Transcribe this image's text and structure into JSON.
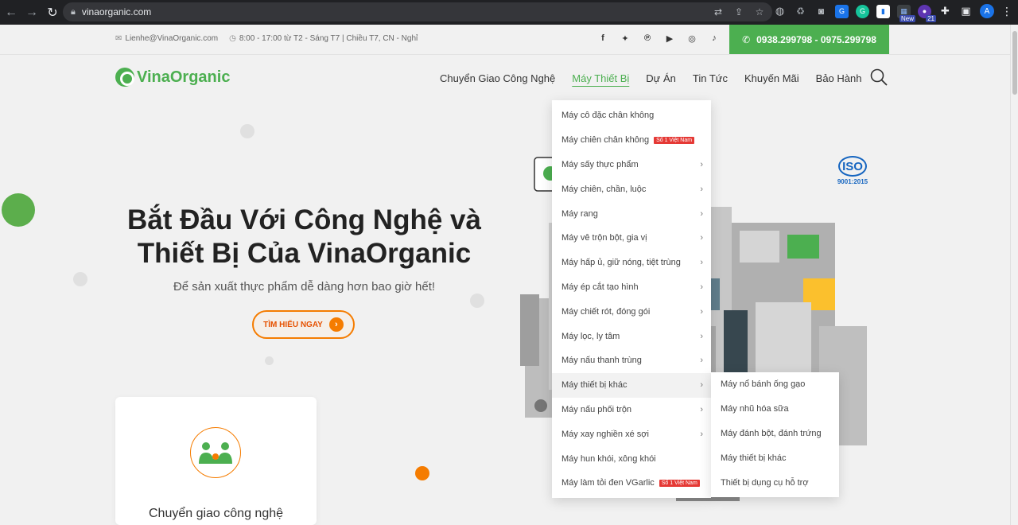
{
  "browser": {
    "url": "vinaorganic.com",
    "profile_initial": "A",
    "ext_new_label": "New",
    "ext_badge": "21"
  },
  "topbar": {
    "email": "Lienhe@VinaOrganic.com",
    "hours": "8:00 - 17:00 từ T2 - Sáng T7 | Chiều T7, CN - Nghỉ",
    "phone": "0938.299798 - 0975.299798"
  },
  "header": {
    "logo": "VinaOrganic",
    "menu": [
      {
        "label": "Chuyển Giao Công Nghệ"
      },
      {
        "label": "Máy Thiết Bị"
      },
      {
        "label": "Dự Án"
      },
      {
        "label": "Tin Tức"
      },
      {
        "label": "Khuyến Mãi"
      },
      {
        "label": "Bảo Hành"
      }
    ]
  },
  "hero": {
    "title_line1": "Bắt Đầu Với Công Nghệ và",
    "title_line2": "Thiết Bị Của VinaOrganic",
    "subtitle": "Để sản xuất thực phẩm dễ dàng hơn bao giờ hết!",
    "cta": "TÌM HIỂU NGAY"
  },
  "card": {
    "title": "Chuyển giao công nghệ"
  },
  "iso": {
    "text": "ISO",
    "sub": "9001:2015"
  },
  "dropdown": {
    "items": [
      {
        "label": "Máy cô đặc chân không"
      },
      {
        "label": "Máy chiên chân không",
        "tag": "Số 1 Việt Nam"
      },
      {
        "label": "Máy sấy thực phẩm"
      },
      {
        "label": "Máy chiên, chần, luộc"
      },
      {
        "label": "Máy rang"
      },
      {
        "label": "Máy vê trộn bột, gia vị"
      },
      {
        "label": "Máy hấp ủ, giữ nóng, tiệt trùng"
      },
      {
        "label": "Máy ép cắt tạo hình"
      },
      {
        "label": "Máy chiết rót, đóng gói"
      },
      {
        "label": "Máy lọc, ly tâm"
      },
      {
        "label": "Máy nấu thanh trùng"
      },
      {
        "label": "Máy thiết bị khác"
      },
      {
        "label": "Máy nấu phối trộn"
      },
      {
        "label": "Máy xay nghiền xé sợi"
      },
      {
        "label": "Máy hun khói, xông khói"
      },
      {
        "label": "Máy làm tỏi đen VGarlic",
        "tag": "Số 1 Việt Nam"
      }
    ],
    "submenu": [
      {
        "label": "Máy nổ bánh ống gạo"
      },
      {
        "label": "Máy nhũ hóa sữa"
      },
      {
        "label": "Máy đánh bột, đánh trứng"
      },
      {
        "label": "Máy thiết bị khác"
      },
      {
        "label": "Thiết bị dụng cụ hỗ trợ"
      }
    ]
  },
  "colors": {
    "brand_green": "#4caf50",
    "accent_orange": "#f57c00",
    "tag_red": "#e53935"
  }
}
